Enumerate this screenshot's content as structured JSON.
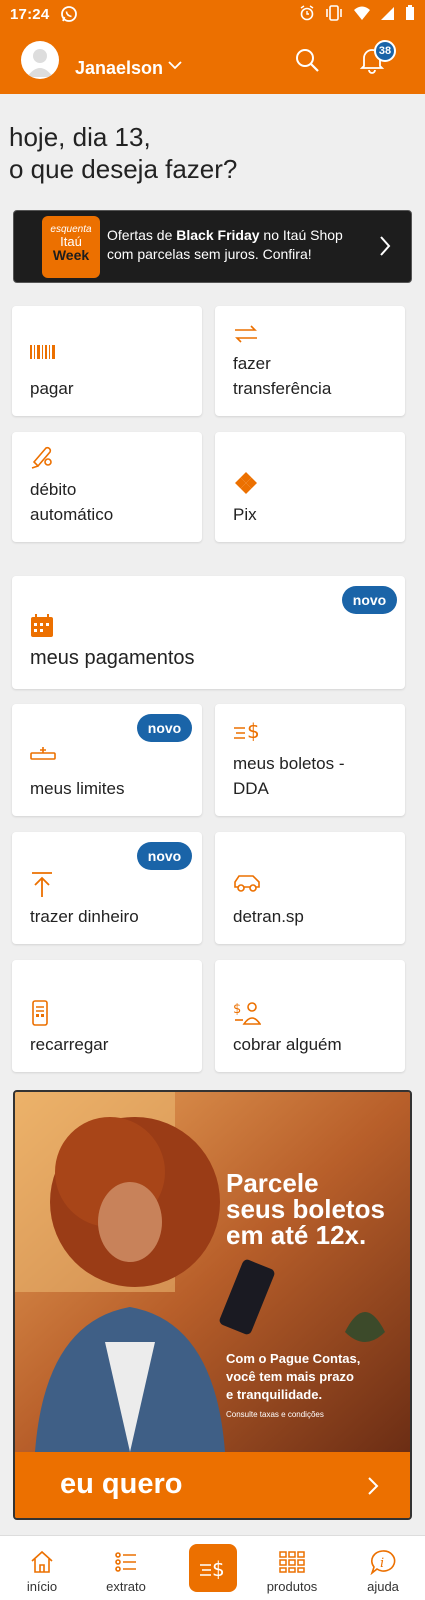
{
  "status_bar": {
    "time": "17:24"
  },
  "header": {
    "username": "Janaelson",
    "notification_count": "38"
  },
  "greeting": {
    "line1": "hoje, dia 13,",
    "line2": "o que deseja fazer?"
  },
  "promo": {
    "logo_line1": "esquenta",
    "logo_line2": "Itaú",
    "logo_line3": "Week",
    "text_prefix": "Ofertas de ",
    "text_bold": "Black Friday",
    "text_suffix": " no Itaú Shop com parcelas sem juros. Confira!"
  },
  "shortcuts": {
    "pagar": "pagar",
    "transferencia_l1": "fazer",
    "transferencia_l2": "transferência",
    "debito_l1": "débito",
    "debito_l2": "automático",
    "pix": "Pix",
    "meus_pagamentos": "meus pagamentos",
    "meus_limites": "meus limites",
    "boletos_l1": "meus boletos -",
    "boletos_l2": "DDA",
    "trazer_dinheiro": "trazer dinheiro",
    "detran": "detran.sp",
    "recarregar": "recarregar",
    "cobrar": "cobrar alguém",
    "new_badge": "novo"
  },
  "banner": {
    "headline_l1": "Parcele",
    "headline_l2": "seus boletos",
    "headline_l3": "em até 12x.",
    "sub_l1": "Com o Pague Contas,",
    "sub_l2": "você tem mais prazo",
    "sub_l3": "e tranquilidade.",
    "small": "Consulte taxas e condições",
    "cta": "eu quero"
  },
  "bottom_nav": {
    "inicio": "início",
    "extrato": "extrato",
    "produtos": "produtos",
    "ajuda": "ajuda"
  },
  "colors": {
    "brand_orange": "#ec7000",
    "badge_blue": "#1a64a8"
  }
}
